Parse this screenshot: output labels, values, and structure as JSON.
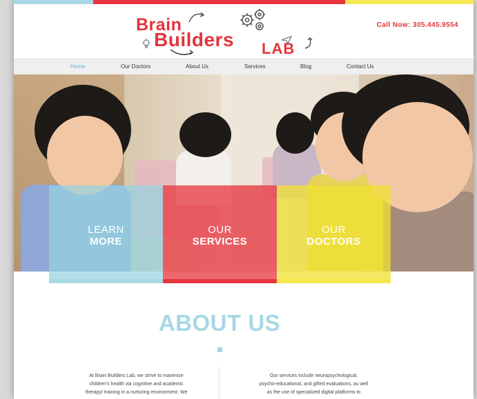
{
  "brand": {
    "logo_word1": "Brain",
    "logo_word2": "Builders",
    "logo_word3": "LAB",
    "phone": "Call Now: 305.445.9554",
    "colors": {
      "blue": "#a6d8e6",
      "red": "#e8353e",
      "yellow": "#f7e654"
    }
  },
  "nav": {
    "items": [
      {
        "label": "Home",
        "active": true
      },
      {
        "label": "Our Doctors"
      },
      {
        "label": "About Us"
      },
      {
        "label": "Services"
      },
      {
        "label": "Blog"
      },
      {
        "label": "Contact Us"
      }
    ]
  },
  "hero": {
    "panels": [
      {
        "line1": "LEARN",
        "line2": "MORE"
      },
      {
        "line1": "OUR",
        "line2": "SERVICES"
      },
      {
        "line1": "OUR",
        "line2": "DOCTORS"
      }
    ]
  },
  "about": {
    "title": "ABOUT US",
    "left_lines": [
      "At Brain Builders Lab, we strive to maximize",
      "children's health via cognitive and academic",
      "therapy/ training in a nurturing environment.  We"
    ],
    "right_lines": [
      "Our services include neuropsychological,",
      "psycho-educational, and gifted evaluations, as well",
      "as the use of specialized digital platforms to"
    ]
  }
}
